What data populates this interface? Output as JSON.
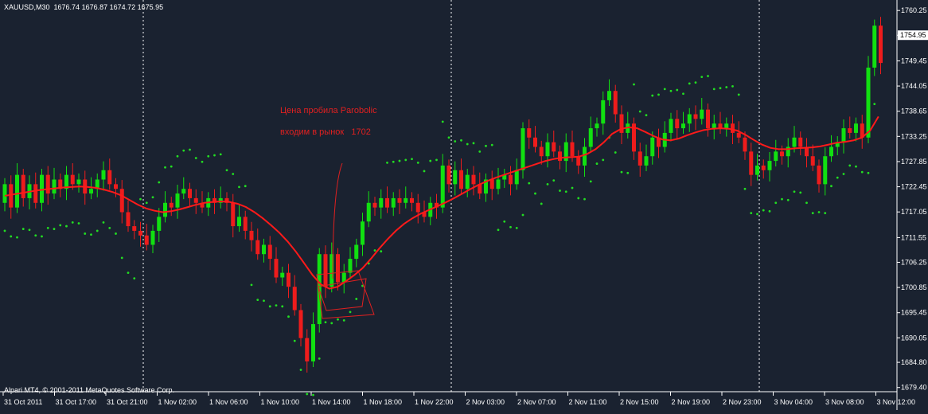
{
  "header": {
    "symbol": "XAUUSD,M30",
    "ohlc": "1676.74 1676.87 1674.72 1675.95"
  },
  "footer": {
    "copyright": "Alpari MT4, © 2001-2011 MetaQuotes Software Corp."
  },
  "annotation": {
    "line1": "Цена пробила Parobolic",
    "line2": "входим в рынок   1702"
  },
  "colors": {
    "background": "#1a2230",
    "bull": "#11e011",
    "bear": "#ee1c1c",
    "ma": "#ff1a1a",
    "sar": "#22dd22",
    "annotation": "#e02020",
    "text": "#ffffff"
  },
  "chart_data": {
    "type": "candlestick",
    "x_ticks": [
      "31 Oct 2011",
      "31 Oct 17:00",
      "31 Oct 21:00",
      "1 Nov 02:00",
      "1 Nov 06:00",
      "1 Nov 10:00",
      "1 Nov 14:00",
      "1 Nov 18:00",
      "1 Nov 22:00",
      "2 Nov 03:00",
      "2 Nov 07:00",
      "2 Nov 11:00",
      "2 Nov 15:00",
      "2 Nov 19:00",
      "2 Nov 23:00",
      "3 Nov 04:00",
      "3 Nov 08:00",
      "3 Nov 12:00"
    ],
    "y_ticks": [
      "1760.25",
      "1754.95",
      "1749.45",
      "1744.05",
      "1738.65",
      "1733.25",
      "1727.85",
      "1722.45",
      "1717.05",
      "1711.55",
      "1706.25",
      "1700.85",
      "1695.45",
      "1690.05",
      "1684.80",
      "1679.40"
    ],
    "ylim": [
      1678.5,
      1762.5
    ],
    "current_price": "1754.95",
    "session_separators": [
      "31 Oct 21:00",
      "1 Nov 22:00",
      "2 Nov 23:00"
    ],
    "candles": [
      [
        1719,
        1723
      ],
      [
        1723,
        1718
      ],
      [
        1718,
        1725
      ],
      [
        1725,
        1720
      ],
      [
        1720,
        1723
      ],
      [
        1723,
        1719
      ],
      [
        1719,
        1725
      ],
      [
        1725,
        1721
      ],
      [
        1721,
        1724
      ],
      [
        1724,
        1722
      ],
      [
        1722,
        1725
      ],
      [
        1725,
        1723
      ],
      [
        1723,
        1724
      ],
      [
        1724,
        1721
      ],
      [
        1721,
        1722
      ],
      [
        1722,
        1724
      ],
      [
        1724,
        1726
      ],
      [
        1726,
        1723
      ],
      [
        1723,
        1722
      ],
      [
        1722,
        1717
      ],
      [
        1717,
        1714
      ],
      [
        1714,
        1713
      ],
      [
        1713,
        1712
      ],
      [
        1712,
        1710
      ],
      [
        1710,
        1713
      ],
      [
        1713,
        1716
      ],
      [
        1716,
        1719
      ],
      [
        1719,
        1718
      ],
      [
        1718,
        1721
      ],
      [
        1721,
        1722
      ],
      [
        1722,
        1720
      ],
      [
        1720,
        1719
      ],
      [
        1719,
        1718
      ],
      [
        1718,
        1720
      ],
      [
        1720,
        1719
      ],
      [
        1719,
        1720
      ],
      [
        1720,
        1719
      ],
      [
        1719,
        1714
      ],
      [
        1714,
        1716
      ],
      [
        1716,
        1713
      ],
      [
        1713,
        1711
      ],
      [
        1711,
        1708
      ],
      [
        1708,
        1710
      ],
      [
        1710,
        1707
      ],
      [
        1707,
        1703
      ],
      [
        1703,
        1704
      ],
      [
        1704,
        1701
      ],
      [
        1701,
        1696
      ],
      [
        1696,
        1690
      ],
      [
        1690,
        1685
      ],
      [
        1685,
        1693
      ],
      [
        1693,
        1708
      ],
      [
        1708,
        1701
      ],
      [
        1701,
        1708
      ],
      [
        1708,
        1702
      ],
      [
        1702,
        1704
      ],
      [
        1704,
        1707
      ],
      [
        1707,
        1710
      ],
      [
        1710,
        1715
      ],
      [
        1715,
        1719
      ],
      [
        1719,
        1718
      ],
      [
        1718,
        1720
      ],
      [
        1720,
        1718
      ],
      [
        1718,
        1720
      ],
      [
        1720,
        1719
      ],
      [
        1719,
        1720
      ],
      [
        1720,
        1719
      ],
      [
        1719,
        1717
      ],
      [
        1717,
        1716
      ],
      [
        1716,
        1719
      ],
      [
        1719,
        1718
      ],
      [
        1718,
        1727
      ],
      [
        1727,
        1723
      ],
      [
        1723,
        1726
      ],
      [
        1726,
        1722
      ],
      [
        1722,
        1725
      ],
      [
        1725,
        1723
      ],
      [
        1723,
        1721
      ],
      [
        1721,
        1724
      ],
      [
        1724,
        1722
      ],
      [
        1722,
        1724
      ],
      [
        1724,
        1725
      ],
      [
        1725,
        1723
      ],
      [
        1723,
        1726
      ],
      [
        1726,
        1735
      ],
      [
        1735,
        1733
      ],
      [
        1733,
        1731
      ],
      [
        1731,
        1729
      ],
      [
        1729,
        1732
      ],
      [
        1732,
        1730
      ],
      [
        1730,
        1728
      ],
      [
        1728,
        1732
      ],
      [
        1732,
        1729
      ],
      [
        1729,
        1727
      ],
      [
        1727,
        1731
      ],
      [
        1731,
        1735
      ],
      [
        1735,
        1736
      ],
      [
        1736,
        1741
      ],
      [
        1741,
        1743
      ],
      [
        1743,
        1738
      ],
      [
        1738,
        1734
      ],
      [
        1734,
        1736
      ],
      [
        1736,
        1730
      ],
      [
        1730,
        1727
      ],
      [
        1727,
        1729
      ],
      [
        1729,
        1733
      ],
      [
        1733,
        1731
      ],
      [
        1731,
        1734
      ],
      [
        1734,
        1737
      ],
      [
        1737,
        1735
      ],
      [
        1735,
        1736
      ],
      [
        1736,
        1738
      ],
      [
        1738,
        1737
      ],
      [
        1737,
        1739
      ],
      [
        1739,
        1735
      ],
      [
        1735,
        1736
      ],
      [
        1736,
        1735
      ],
      [
        1735,
        1736
      ],
      [
        1736,
        1734
      ],
      [
        1734,
        1733
      ],
      [
        1733,
        1730
      ],
      [
        1730,
        1725
      ],
      [
        1725,
        1727
      ],
      [
        1727,
        1726
      ],
      [
        1726,
        1728
      ],
      [
        1728,
        1730
      ],
      [
        1730,
        1729
      ],
      [
        1729,
        1731
      ],
      [
        1731,
        1733
      ],
      [
        1733,
        1731
      ],
      [
        1731,
        1729
      ],
      [
        1729,
        1727
      ],
      [
        1727,
        1723
      ],
      [
        1723,
        1729
      ],
      [
        1729,
        1731
      ],
      [
        1731,
        1732
      ],
      [
        1732,
        1735
      ],
      [
        1735,
        1734
      ],
      [
        1734,
        1736
      ],
      [
        1736,
        1733
      ],
      [
        1733,
        1748
      ],
      [
        1748,
        1757
      ],
      [
        1757,
        1749
      ]
    ],
    "moving_average": [
      1720.5,
      1720.8,
      1721.1,
      1721.4,
      1721.7,
      1721.9,
      1722.1,
      1722.3,
      1722.4,
      1722.5,
      1722.4,
      1722.2,
      1721.8,
      1721.3,
      1720.6,
      1719.6,
      1718.6,
      1717.8,
      1717.3,
      1717.0,
      1717.2,
      1717.6,
      1718.1,
      1718.6,
      1719.0,
      1719.2,
      1719.3,
      1719.2,
      1718.8,
      1718.1,
      1717.0,
      1715.7,
      1714.2,
      1712.6,
      1710.7,
      1708.5,
      1706.0,
      1703.5,
      1701.5,
      1700.6,
      1701.0,
      1702.2,
      1703.5,
      1705.0,
      1707.0,
      1709.2,
      1711.2,
      1713.0,
      1714.5,
      1715.7,
      1716.7,
      1717.5,
      1718.3,
      1719.1,
      1720.0,
      1721.0,
      1722.0,
      1722.9,
      1723.7,
      1724.4,
      1725.0,
      1725.6,
      1726.2,
      1726.8,
      1727.4,
      1728.0,
      1728.4,
      1728.7,
      1728.8,
      1728.9,
      1729.5,
      1730.5,
      1732.0,
      1733.8,
      1734.8,
      1735.2,
      1735.0,
      1734.2,
      1733.3,
      1732.6,
      1732.4,
      1732.8,
      1733.5,
      1734.1,
      1734.6,
      1734.9,
      1735.0,
      1734.9,
      1734.5,
      1733.6,
      1732.5,
      1731.5,
      1730.8,
      1730.5,
      1730.5,
      1730.7,
      1730.8,
      1730.9,
      1731.1,
      1731.5,
      1731.9,
      1732.1,
      1732.4,
      1733.0,
      1734.5,
      1737.5
    ]
  }
}
